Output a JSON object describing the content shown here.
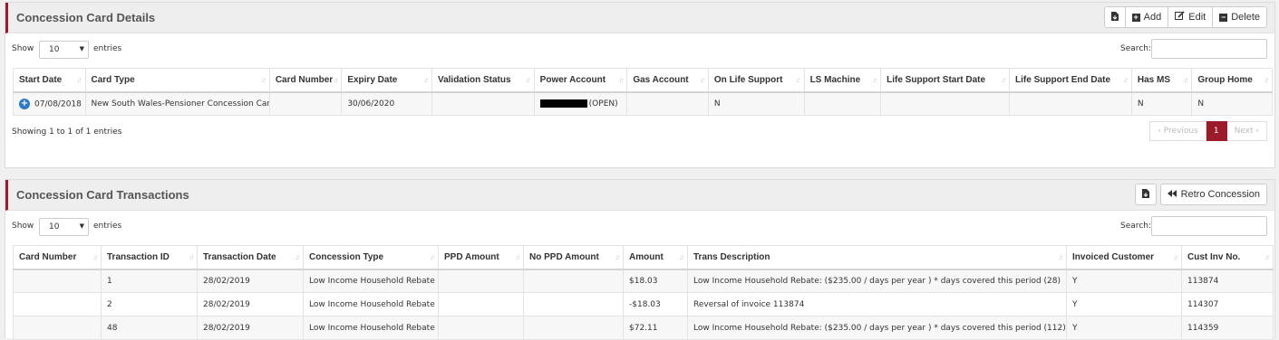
{
  "details": {
    "title": "Concession Card Details",
    "buttons": {
      "add": "Add",
      "edit": "Edit",
      "delete": "Delete"
    },
    "show_label": "Show",
    "entries_value": "10",
    "entries_label": "entries",
    "search_label": "Search:",
    "columns": [
      "Start Date",
      "Card Type",
      "Card Number",
      "Expiry Date",
      "Validation Status",
      "Power Account",
      "Gas Account",
      "On Life Support",
      "LS Machine",
      "Life Support Start Date",
      "Life Support End Date",
      "Has MS",
      "Group Home"
    ],
    "row": {
      "start_date": "07/08/2018",
      "card_type": "New South Wales-Pensioner Concession Card",
      "card_number": "",
      "expiry_date": "30/06/2020",
      "validation_status": "",
      "power_account": "(OPEN)",
      "gas_account": "",
      "on_life_support": "N",
      "ls_machine": "",
      "ls_start": "",
      "ls_end": "",
      "has_ms": "N",
      "group_home": "N"
    },
    "info": "Showing 1 to 1 of 1 entries",
    "pager": {
      "previous": "Previous",
      "page": "1",
      "next": "Next"
    }
  },
  "transactions": {
    "title": "Concession Card Transactions",
    "buttons": {
      "retro": "Retro Concession"
    },
    "show_label": "Show",
    "entries_value": "10",
    "entries_label": "entries",
    "search_label": "Search:",
    "columns": [
      "Card Number",
      "Transaction ID",
      "Transaction Date",
      "Concession Type",
      "PPD Amount",
      "No PPD Amount",
      "Amount",
      "Trans Description",
      "Invoiced Customer",
      "Cust Inv No."
    ],
    "rows": [
      {
        "card_number": "",
        "id": "1",
        "date": "28/02/2019",
        "type": "Low Income Household Rebate",
        "ppd": "",
        "no_ppd": "",
        "amount": "$18.03",
        "desc": "Low Income Household Rebate: ($235.00 / days per year ) * days covered this period (28)",
        "invoiced": "Y",
        "inv_no": "113874"
      },
      {
        "card_number": "",
        "id": "2",
        "date": "28/02/2019",
        "type": "Low Income Household Rebate",
        "ppd": "",
        "no_ppd": "",
        "amount": "-$18.03",
        "desc": "Reversal of invoice 113874",
        "invoiced": "Y",
        "inv_no": "114307"
      },
      {
        "card_number": "",
        "id": "48",
        "date": "28/02/2019",
        "type": "Low Income Household Rebate",
        "ppd": "",
        "no_ppd": "",
        "amount": "$72.11",
        "desc": "Low Income Household Rebate: ($235.00 / days per year ) * days covered this period (112)",
        "invoiced": "Y",
        "inv_no": "114359"
      }
    ]
  },
  "icons": {
    "export": "file-export-icon",
    "add": "plus-square-icon",
    "edit": "edit-icon",
    "delete": "minus-square-icon",
    "retro": "fast-backward-icon",
    "expand": "plus-circle-icon",
    "sort": "sort-icon",
    "caret": "caret-down-icon"
  },
  "colors": {
    "accent": "#9b1b2a",
    "expand": "#2c79c8",
    "header_bg": "#eeeeee"
  }
}
